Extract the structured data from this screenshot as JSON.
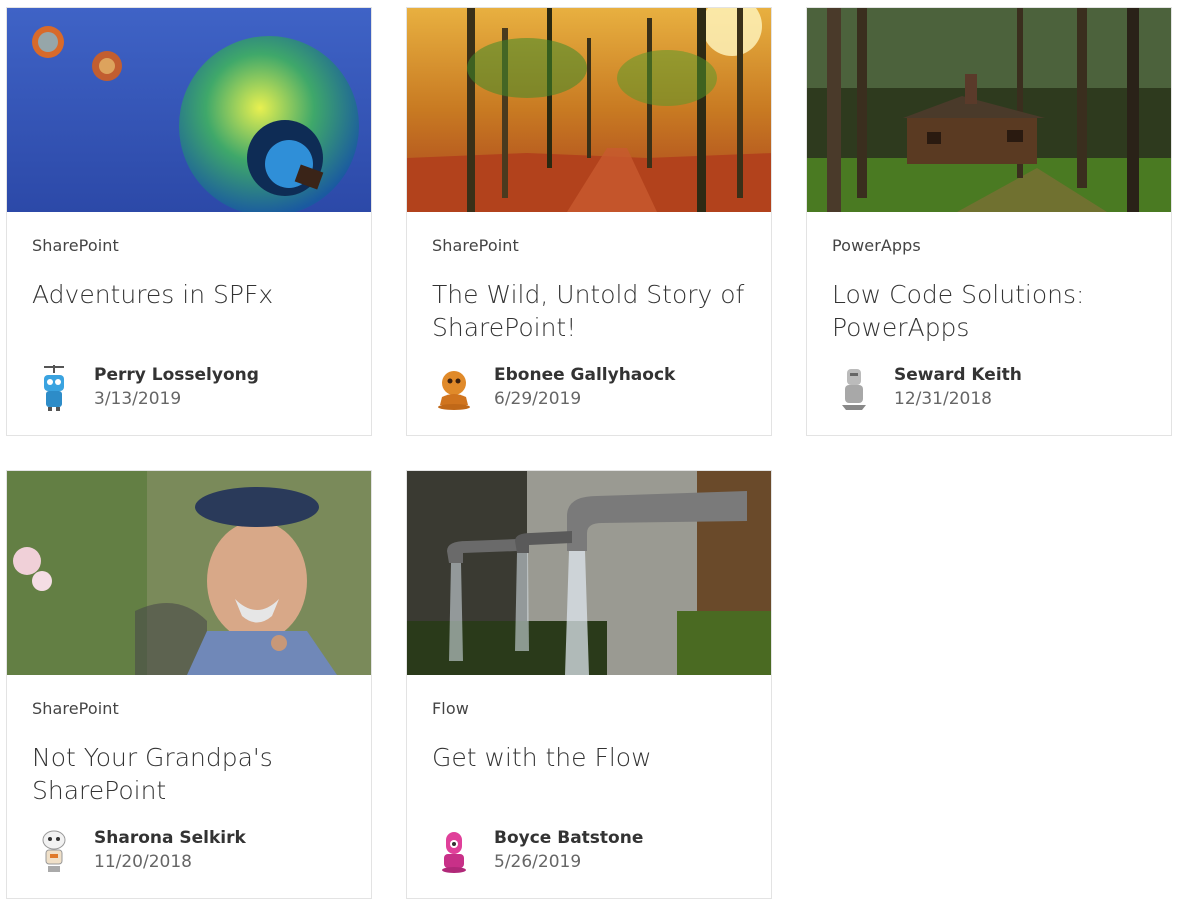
{
  "cards": [
    {
      "category": "SharePoint",
      "title": "Adventures in SPFx",
      "author": "Perry Losselyong",
      "date": "3/13/2019",
      "image": "hot-air-balloons",
      "avatar": "blue-robot"
    },
    {
      "category": "SharePoint",
      "title": "The Wild, Untold Story of SharePoint!",
      "author": "Ebonee Gallyhaock",
      "date": "6/29/2019",
      "image": "autumn-forest",
      "avatar": "orange-robot"
    },
    {
      "category": "PowerApps",
      "title": "Low Code Solutions: PowerApps",
      "author": "Seward Keith",
      "date": "12/31/2018",
      "image": "forest-cabin",
      "avatar": "grey-robot"
    },
    {
      "category": "SharePoint",
      "title": "Not Your Grandpa's SharePoint",
      "author": "Sharona Selkirk",
      "date": "11/20/2018",
      "image": "old-man-with-cap",
      "avatar": "white-robot"
    },
    {
      "category": "Flow",
      "title": "Get with the Flow",
      "author": "Boyce Batstone",
      "date": "5/26/2019",
      "image": "water-taps",
      "avatar": "pink-robot"
    }
  ]
}
